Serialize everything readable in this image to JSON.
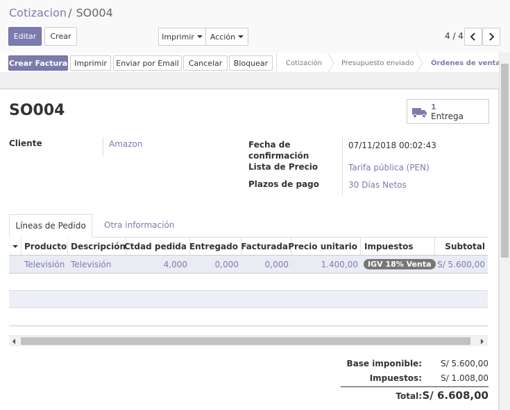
{
  "breadcrumb": {
    "parent": "Cotizacion",
    "separator": "/",
    "current": "SO004"
  },
  "toolbar": {
    "edit_label": "Editar",
    "create_label": "Crear",
    "print_label": "Imprimir",
    "action_label": "Acción"
  },
  "pager": {
    "value": "4 / 4"
  },
  "header_buttons": {
    "create_invoice": "Crear Factura",
    "print": "Imprimir",
    "send_email": "Enviar por Email",
    "cancel": "Cancelar",
    "lock": "Bloquear"
  },
  "statusbar": {
    "stages": [
      "Cotización",
      "Presupuesto enviado",
      "Órdenes de venta"
    ],
    "active_stage": "Órdenes de venta"
  },
  "document": {
    "name": "SO004"
  },
  "smart_button": {
    "count": "1",
    "label": "Entrega",
    "icon": "truck-icon"
  },
  "fields": {
    "customer_label": "Cliente",
    "customer_value": "Amazon",
    "confirmation_label_1": "Fecha de",
    "confirmation_label_2": "confirmación",
    "confirmation_value": "07/11/2018 00:02:43",
    "pricelist_label": "Lista de Precio",
    "pricelist_value": "Tarifa pública (PEN)",
    "payment_terms_label": "Plazos de pago",
    "payment_terms_value": "30 Días Netos"
  },
  "tabs": {
    "order_lines": "Líneas de Pedido",
    "other_info": "Otra información"
  },
  "table": {
    "headers": [
      "Producto",
      "Descripción",
      "Ctdad pedida",
      "Entregado",
      "Facturada",
      "Precio unitario",
      "Impuestos",
      "Subtotal"
    ],
    "rows": [
      {
        "product": "Televisión",
        "description": "Televisión",
        "qty": "4,000",
        "delivered": "0,000",
        "invoiced": "0,000",
        "price": "1.400,00",
        "tax": "IGV 18% Venta",
        "subtotal": "S/ 5.600,00"
      }
    ]
  },
  "totals": {
    "base_label": "Base imponible:",
    "base_value": "S/ 5.600,00",
    "tax_label": "Impuestos:",
    "tax_value": "S/ 1.008,00",
    "total_label": "Total:",
    "total_value": "S/ 6.608,00"
  },
  "colors": {
    "primary": "#7c7bad",
    "badge": "#777777"
  }
}
